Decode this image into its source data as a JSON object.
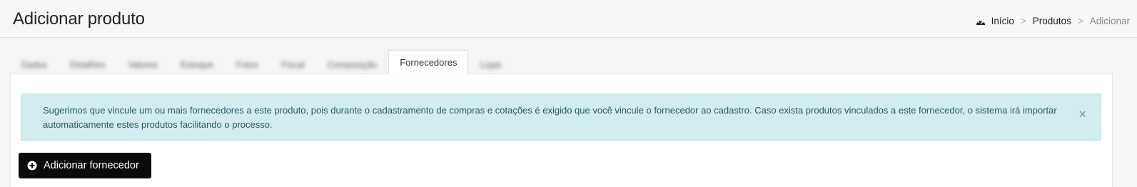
{
  "header": {
    "title": "Adicionar produto",
    "breadcrumb": [
      {
        "label": "Início",
        "icon": "dashboard-icon"
      },
      {
        "label": "Produtos"
      },
      {
        "label": "Adicionar"
      }
    ],
    "separator": ">"
  },
  "tabs": [
    {
      "label": "Dados"
    },
    {
      "label": "Detalhes"
    },
    {
      "label": "Valores"
    },
    {
      "label": "Estoque"
    },
    {
      "label": "Fotos"
    },
    {
      "label": "Fiscal"
    },
    {
      "label": "Composição"
    },
    {
      "label": "Fornecedores"
    },
    {
      "label": "Lojas"
    }
  ],
  "alert": {
    "text": "Sugerimos que vincule um ou mais fornecedores a este produto, pois durante o cadastramento de compras e cotações é exigido que você vincule o fornecedor ao cadastro. Caso exista produtos vinculados a este fornecedor, o sistema irá importar automaticamente estes produtos facilitando o processo.",
    "close": "×"
  },
  "actions": {
    "add_supplier": "Adicionar fornecedor"
  }
}
